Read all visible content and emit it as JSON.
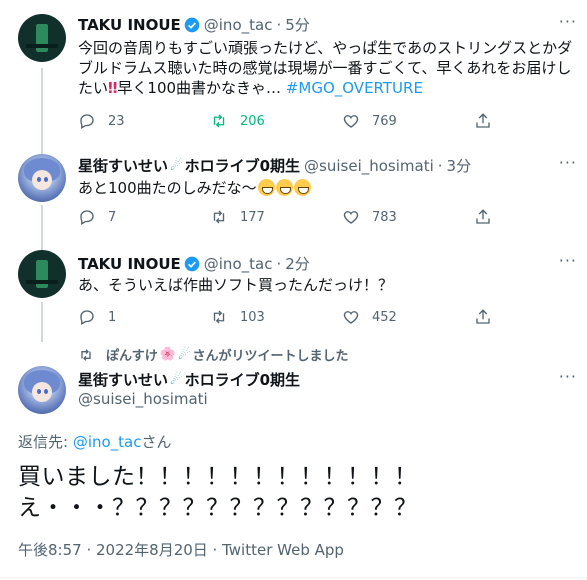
{
  "tweets": [
    {
      "name": "TAKU INOUE",
      "handle": "@ino_tac",
      "dot": "·",
      "time": "5分",
      "text_1": "今回の音周りもすごい頑張ったけど、やっぱ生であのストリングスとかダブルドラムス聴いた時の感覚は現場が一番すごくて、早くあれをお届けしたい",
      "emoji_1": "‼",
      "text_2": "早く100曲書かなきゃ… ",
      "hashtag": "#MGO_OVERTURE",
      "replies": "23",
      "retweets": "206",
      "likes": "769"
    },
    {
      "name": "星街すいせい",
      "name_suffix": "ホロライブ0期生",
      "handle": "@suisei_hosimati",
      "dot": "·",
      "time": "3分",
      "text": "あと100曲たのしみだな～",
      "replies": "7",
      "retweets": "177",
      "likes": "783"
    },
    {
      "name": "TAKU INOUE",
      "handle": "@ino_tac",
      "dot": "·",
      "time": "2分",
      "text": "あ、そういえば作曲ソフト買ったんだっけ！？",
      "replies": "1",
      "retweets": "103",
      "likes": "452"
    }
  ],
  "retweet_bar": {
    "name": "ぽんすけ",
    "flower": "🌸",
    "suffix": "さんがリツイートしました"
  },
  "main_tweet": {
    "name": "星街すいせい",
    "name_suffix": "ホロライブ0期生",
    "handle": "@suisei_hosimati",
    "reply_prefix": "返信先: ",
    "reply_mention": "@ino_tac",
    "reply_suffix": "さん",
    "line_1": "買いました！！！！！！！！！！！！",
    "line_2": "え・・・？？？？？？？？？？？？？",
    "meta": "午後8:57 · 2022年8月20日 · Twitter Web App"
  },
  "icons": {
    "more": "more-icon",
    "reply": "reply-icon",
    "retweet": "retweet-icon",
    "like": "heart-icon",
    "share": "share-icon",
    "verified": "verified-badge-icon",
    "comet": "comet-icon"
  },
  "colors": {
    "accent": "#1d9bf0",
    "retweet_active": "#00ba7c",
    "muted": "#536471",
    "text": "#0f1419"
  }
}
